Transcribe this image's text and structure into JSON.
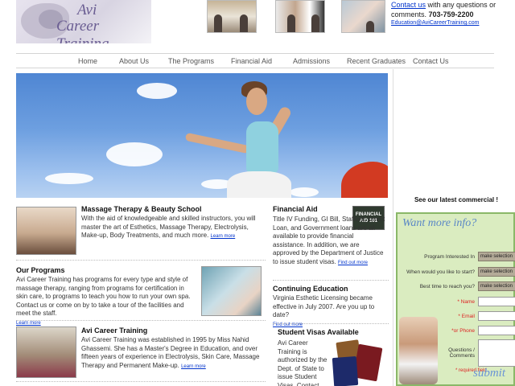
{
  "logo": {
    "line1": "Avi",
    "line2": "Career Training"
  },
  "header": {
    "contact_link": "Contact us",
    "contact_text": " with any questions or comments. ",
    "phone": "703-759-2200",
    "email": "Education@AviCareerTraining.com"
  },
  "nav": {
    "items": [
      {
        "label": "Home"
      },
      {
        "label": "About Us"
      },
      {
        "label": "The Programs"
      },
      {
        "label": "Financial Aid"
      },
      {
        "label": "Admissions"
      },
      {
        "label": "Recent Graduates"
      },
      {
        "label": "Contact Us"
      }
    ]
  },
  "sections": {
    "massage": {
      "title": "Massage Therapy & Beauty School",
      "body": "With the aid of knowledgeable and skilled instructors, you will master the art of Esthetics, Massage Therapy, Electrolysis, Make-up, Body Treatments, and much more.",
      "more": "Learn more"
    },
    "programs": {
      "title": "Our Programs",
      "body": "Avi Career Training has programs for every type and style of massage therapy, ranging from programs for certification in skin care, to programs to teach you how to run your own spa. Contact us or come on by to take a tour of the facilities and meet the staff.",
      "more": "Learn more"
    },
    "avi": {
      "title": "Avi Career Training",
      "body": "Avi Career Training was established in 1995 by Miss Nahid Ghassemi. She has a Master's Degree in Education, and over fifteen years of experience in Electrolysis, Skin Care, Massage Therapy and Permanent Make-up.",
      "more": "Learn more"
    },
    "financial": {
      "title": "Financial Aid",
      "body": "Title IV Funding, GI Bill, Stafford, Direct Loan, and Government loans are all available to provide financial assistance. In addition, we are approved by the Department of Justice to issue student visas.",
      "more": "Find out more",
      "badge": "FINANCIAL AID 101"
    },
    "continuing": {
      "title": "Continuing Education",
      "body": "Virginia Esthetic Licensing became effective in July 2007. Are you up to date?",
      "more": "Find out more"
    },
    "visas": {
      "title": "Student Visas Available",
      "body": "Avi Career Training is authorized by the Dept. of State to issue Student Visas. Contact our"
    }
  },
  "sidebar": {
    "commercial": "See our latest commercial !",
    "form": {
      "title": "Want more info?",
      "fields": [
        {
          "label": "Program Interested In",
          "value": "make selection"
        },
        {
          "label": "When would you like to start?",
          "value": "make selection"
        },
        {
          "label": "Best time to reach you?",
          "value": "make selection"
        },
        {
          "label": "* Name"
        },
        {
          "label": "* Email"
        },
        {
          "label": "*or Phone"
        },
        {
          "label": "Questions / Comments"
        }
      ],
      "required_note": "* required field",
      "submit": "submit"
    }
  },
  "colors": {
    "link": "#0033cc",
    "form_bg": "#daecc0",
    "form_border": "#8ab868",
    "heading_accent": "#6a5d92"
  }
}
